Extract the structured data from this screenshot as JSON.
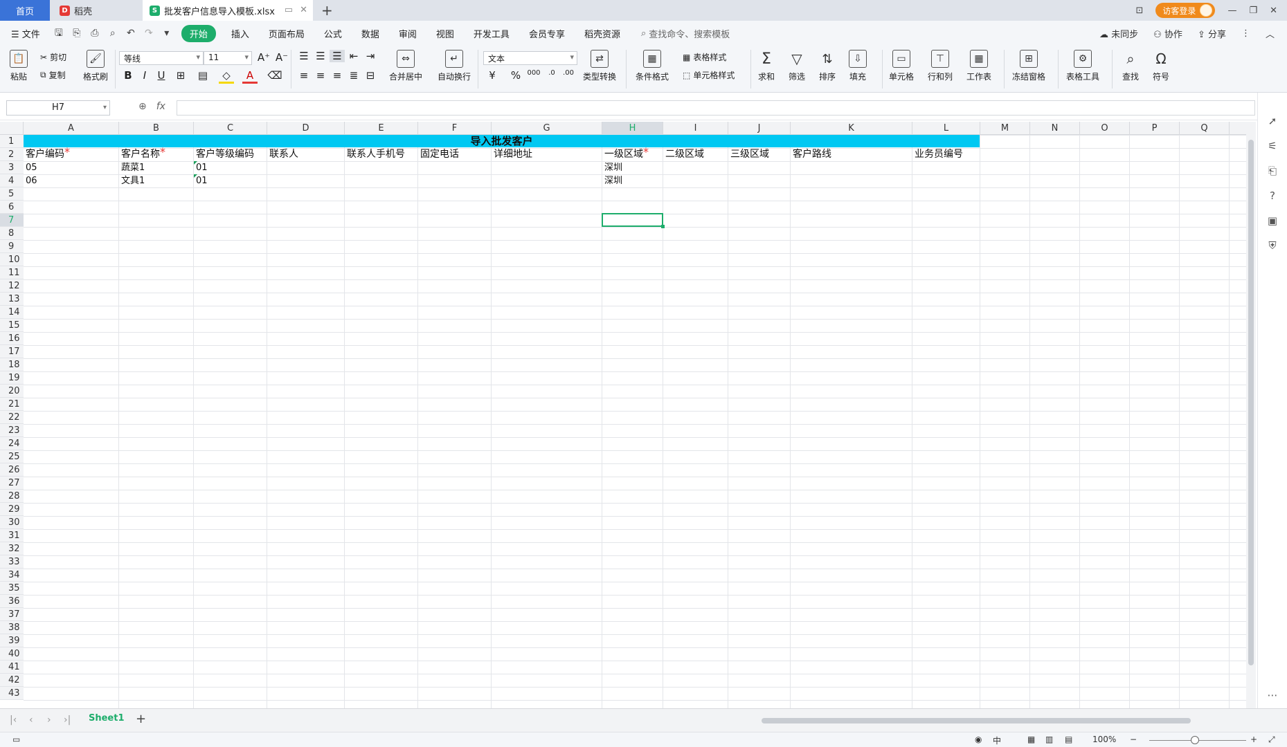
{
  "tabbar": {
    "home": "首页",
    "daoke": "稻壳",
    "file": "批发客户信息导入模板.xlsx",
    "file_logo": "S",
    "login": "访客登录"
  },
  "menubar": {
    "file": "文件",
    "items": [
      "开始",
      "插入",
      "页面布局",
      "公式",
      "数据",
      "审阅",
      "视图",
      "开发工具",
      "会员专享",
      "稻壳资源"
    ],
    "search": "查找命令、搜索模板",
    "unsynced": "未同步",
    "collab": "协作",
    "share": "分享"
  },
  "ribbon": {
    "paste": "粘贴",
    "cut": "剪切",
    "copy": "复制",
    "format_painter": "格式刷",
    "font_name": "等线",
    "font_size": "11",
    "merge_center": "合并居中",
    "wrap": "自动换行",
    "number_format": "文本",
    "type_convert": "类型转换",
    "cond_format": "条件格式",
    "table_style": "表格样式",
    "cell_style": "单元格样式",
    "sum": "求和",
    "filter": "筛选",
    "sort": "排序",
    "fill": "填充",
    "cell": "单元格",
    "row_col": "行和列",
    "worksheet": "工作表",
    "freeze": "冻结窗格",
    "table_tools": "表格工具",
    "find": "查找",
    "symbol": "符号"
  },
  "formula": {
    "namebox": "H7",
    "fx": "fx",
    "content": ""
  },
  "columns": [
    "A",
    "B",
    "C",
    "D",
    "E",
    "F",
    "G",
    "H",
    "I",
    "J",
    "K",
    "L",
    "M",
    "N",
    "O",
    "P",
    "Q"
  ],
  "rows": [
    "1",
    "2",
    "3",
    "4",
    "5",
    "6",
    "7",
    "8",
    "9",
    "10",
    "11",
    "12",
    "13",
    "14",
    "15",
    "16",
    "17",
    "18",
    "19",
    "20",
    "21",
    "22",
    "23",
    "24",
    "25",
    "26",
    "27",
    "28",
    "29",
    "30",
    "31",
    "32",
    "33",
    "34",
    "35",
    "36",
    "37",
    "38",
    "39",
    "40",
    "41",
    "42",
    "43"
  ],
  "sheet": {
    "title": "导入批发客户",
    "headers": [
      {
        "label": "客户编码",
        "required": true
      },
      {
        "label": "客户名称",
        "required": true
      },
      {
        "label": "客户等级编码",
        "required": false
      },
      {
        "label": "联系人",
        "required": false
      },
      {
        "label": "联系人手机号",
        "required": false
      },
      {
        "label": "固定电话",
        "required": false
      },
      {
        "label": "详细地址",
        "required": false
      },
      {
        "label": "一级区域",
        "required": true
      },
      {
        "label": "二级区域",
        "required": false
      },
      {
        "label": "三级区域",
        "required": false
      },
      {
        "label": "客户路线",
        "required": false
      },
      {
        "label": "业务员编号",
        "required": false
      }
    ],
    "data": [
      [
        "05",
        "蔬菜1",
        "01",
        "",
        "",
        "",
        "",
        "深圳",
        "",
        "",
        "",
        ""
      ],
      [
        "06",
        "文具1",
        "01",
        "",
        "",
        "",
        "",
        "深圳",
        "",
        "",
        "",
        ""
      ]
    ],
    "selected_cell": "H7"
  },
  "sheettabs": {
    "active": "Sheet1"
  },
  "status": {
    "zoom": "100%"
  },
  "colors": {
    "accent": "#1dad6b",
    "banner": "#00c8f2",
    "home_tab": "#3a73d8",
    "required": "#e53935"
  }
}
